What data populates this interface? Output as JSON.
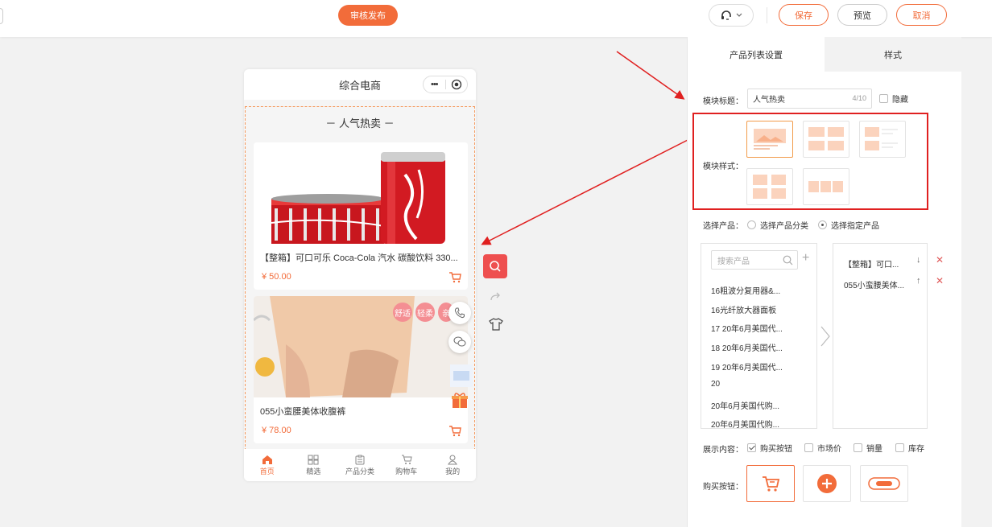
{
  "topbar": {
    "publish_label": "审核发布",
    "save_label": "保存",
    "preview_label": "预览",
    "cancel_label": "取消",
    "service_icon": "headset-icon"
  },
  "phone": {
    "title": "综合电商",
    "capsule_dots": "•••",
    "module_title": "－ 人气热卖 －",
    "products": [
      {
        "name": "【整箱】可口可乐 Coca-Cola 汽水 碳酸饮料 330...",
        "price": "¥ 50.00"
      },
      {
        "name": "055小蛮腰美体收腹裤",
        "price": "¥ 78.00",
        "tags": [
          "舒适",
          "轻柔",
          "亲"
        ]
      }
    ],
    "tabs": [
      {
        "label": "首页",
        "icon": "home-icon",
        "active": true
      },
      {
        "label": "精选",
        "icon": "grid-icon",
        "active": false
      },
      {
        "label": "产品分类",
        "icon": "clipboard-icon",
        "active": false
      },
      {
        "label": "购物车",
        "icon": "cart-icon",
        "active": false
      },
      {
        "label": "我的",
        "icon": "user-icon",
        "active": false
      }
    ]
  },
  "panel": {
    "tabs": [
      {
        "label": "产品列表设置",
        "active": true
      },
      {
        "label": "样式",
        "active": false
      }
    ],
    "module_title_label": "模块标题：",
    "module_title_value": "人气热卖",
    "module_title_count": "4/10",
    "hide_label": "隐藏",
    "module_style_label": "模块样式：",
    "select_product_label": "选择产品：",
    "radio_category": "选择产品分类",
    "radio_specific": "选择指定产品",
    "search_placeholder": "搜索产品",
    "product_list": [
      "16粗波分复用器&...",
      "16光纤放大器面板",
      "17 20年6月美国代...",
      "18 20年6月美国代...",
      "19 20年6月美国代...",
      "20",
      "20年6月美国代购...",
      "20年6月美国代购..."
    ],
    "selected_products": [
      "【整箱】可口...",
      "055小蛮腰美体..."
    ],
    "display_label": "展示内容：",
    "display_options": [
      {
        "label": "购买按钮",
        "checked": true
      },
      {
        "label": "市场价",
        "checked": false
      },
      {
        "label": "销量",
        "checked": false
      },
      {
        "label": "库存",
        "checked": false
      }
    ],
    "buy_button_label": "购买按钮："
  },
  "colors": {
    "accent": "#f26c3a",
    "highlight_box": "#e02020",
    "tool_red": "#ee4f4f"
  }
}
